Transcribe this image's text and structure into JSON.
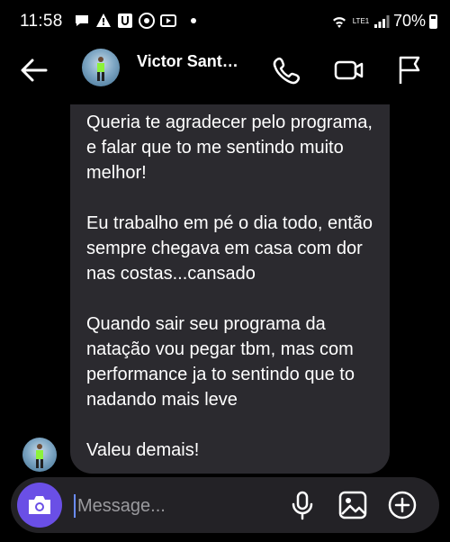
{
  "status_bar": {
    "time": "11:58",
    "battery": "70%",
    "network": "LTE1"
  },
  "header": {
    "contact_name": "Victor Sant…",
    "icons": [
      "back-arrow-icon",
      "phone-icon",
      "video-camera-icon",
      "flag-icon"
    ]
  },
  "conversation": {
    "message_paragraphs": [
      "Queria te agradecer pelo programa, e falar que to me sentindo muito melhor!",
      "Eu trabalho em pé o dia todo, então sempre chegava em casa com dor nas costas...cansado",
      "Quando sair seu programa da natação vou pegar tbm, mas com performance ja to sentindo que to nadando mais leve",
      "Valeu demais!"
    ]
  },
  "composer": {
    "placeholder": "Message...",
    "icons": [
      "camera-icon",
      "microphone-icon",
      "image-icon",
      "add-circle-icon"
    ]
  },
  "colors": {
    "background": "#000000",
    "bubble": "#2b2a2f",
    "accent": "#6a4fe6"
  }
}
